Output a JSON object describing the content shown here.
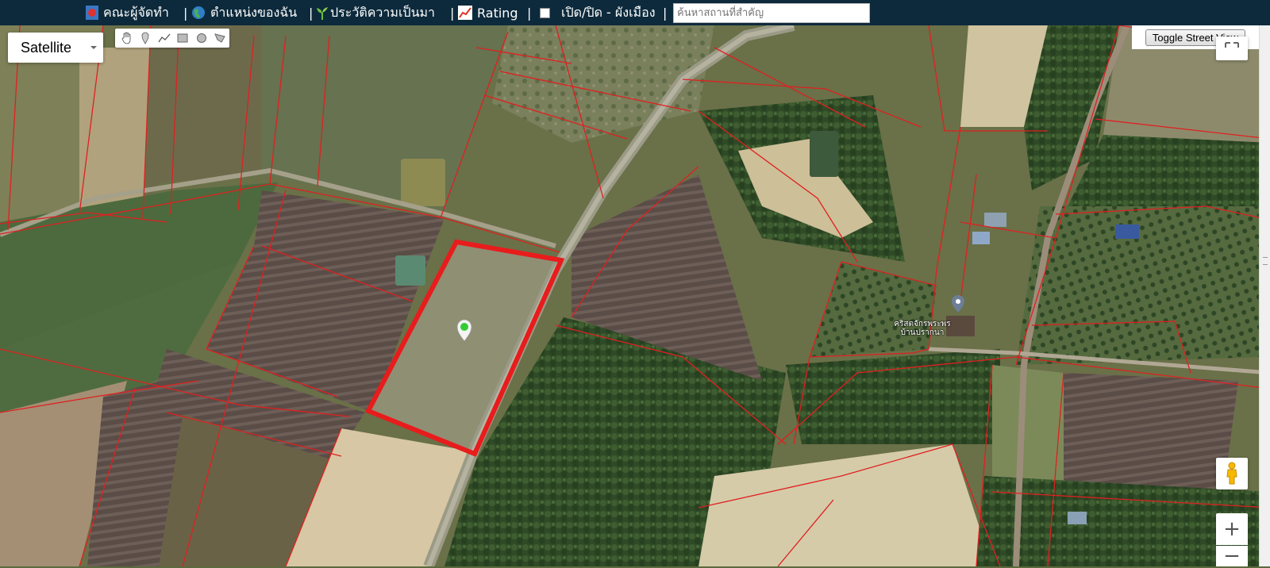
{
  "topbar": {
    "items": [
      {
        "label": "คณะผู้จัดทำ",
        "icon": "team-icon"
      },
      {
        "label": "ตำแหน่งของฉัน",
        "icon": "globe-icon"
      },
      {
        "label": "ประวัติความเป็นมา",
        "icon": "sprout-icon"
      },
      {
        "label": "Rating",
        "icon": "chart-icon"
      },
      {
        "label": "เปิด/ปิด - ผังเมือง",
        "icon": "checkbox-icon"
      }
    ],
    "separator": "|",
    "search_placeholder": "ค้นหาสถานที่สำคัญ",
    "background": "#0d2a3c"
  },
  "map": {
    "map_type": "Satellite",
    "toggle_street_view": "Toggle Street View",
    "zoom_in": "+",
    "zoom_out": "−",
    "poi_label": "คริสตจักรพระพรบ้านปรากนา",
    "drawing_tools": [
      "hand-icon",
      "marker-icon",
      "polyline-icon",
      "rectangle-icon",
      "circle-icon",
      "polygon-icon"
    ],
    "parcel_line_color": "#e02020",
    "highlight_color": "#e81c1c"
  }
}
